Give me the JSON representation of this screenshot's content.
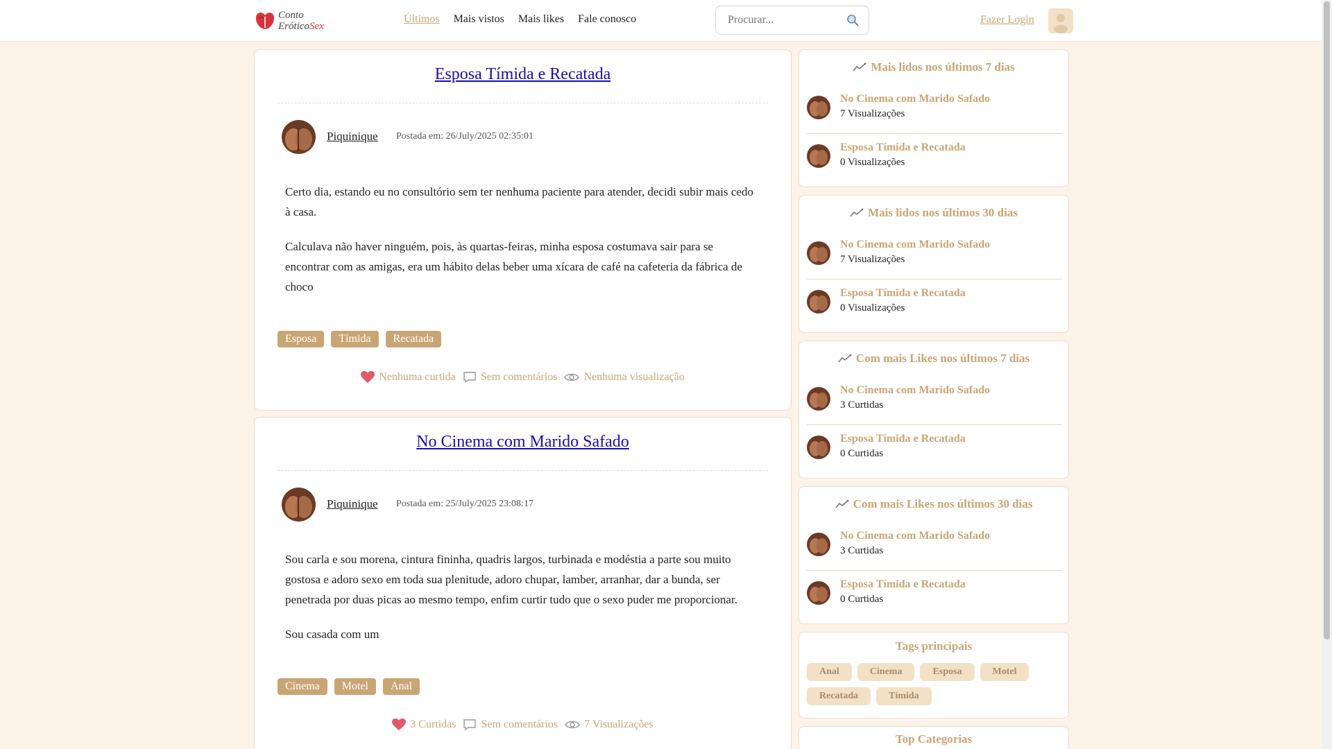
{
  "header": {
    "logo_line1": "Conto",
    "logo_line2": "Erótico",
    "logo_line3": "Sex",
    "nav": [
      "Últimos",
      "Mais vistos",
      "Mais likes",
      "Fale conosco"
    ],
    "search_placeholder": "Procurar...",
    "login": "Fazer Login"
  },
  "posts": [
    {
      "title": "Esposa Tímida e Recatada",
      "author": "Piquinique",
      "date": "Postada em: 26/July/2025 02:35:01",
      "paragraphs": [
        "Certo dia, estando eu no consultório sem ter nenhuma paciente para atender, decidi subir mais cedo à casa.",
        "Calculava não haver ninguém, pois, às quartas-feiras, minha esposa costumava sair para se encontrar com as amigas, era um hábito delas beber uma xícara de café na cafeteria da fábrica de choco"
      ],
      "tags": [
        "Esposa",
        "Tímida",
        "Recatada"
      ],
      "likes": "Nenhuma curtida",
      "comments": "Sem comentários",
      "views": "Nenhuma visualização"
    },
    {
      "title": "No Cinema com Marido Safado",
      "author": "Piquinique",
      "date": "Postada em: 25/July/2025 23:08:17",
      "paragraphs": [
        "Sou carla e sou morena, cintura fininha, quadris largos, turbinada e modéstia a parte sou muito gostosa e adoro sexo em toda sua plenitude, adoro chupar, lamber, arranhar, dar a bunda, ser penetrada por duas picas ao mesmo tempo, enfim curtir tudo que o sexo puder me proporcionar.",
        "Sou casada com um"
      ],
      "tags": [
        "Cinema",
        "Motel",
        "Anal"
      ],
      "likes": "3 Curtidas",
      "comments": "Sem comentários",
      "views": "7 Visualizações"
    }
  ],
  "sidebar": [
    {
      "title": "Mais lidos nos últimos 7 dias",
      "items": [
        {
          "name": "No Cinema com Marido Safado",
          "meta": "7 Visualizações"
        },
        {
          "name": "Esposa Tímida e Recatada",
          "meta": "0 Visualizações"
        }
      ]
    },
    {
      "title": "Mais lidos nos últimos 30 dias",
      "items": [
        {
          "name": "No Cinema com Marido Safado",
          "meta": "7 Visualizações"
        },
        {
          "name": "Esposa Tímida e Recatada",
          "meta": "0 Visualizações"
        }
      ]
    },
    {
      "title": "Com mais Likes nos últimos 7 dias",
      "items": [
        {
          "name": "No Cinema com Marido Safado",
          "meta": "3 Curtidas"
        },
        {
          "name": "Esposa Tímida e Recatada",
          "meta": "0 Curtidas"
        }
      ]
    },
    {
      "title": "Com mais Likes nos últimos 30 dias",
      "items": [
        {
          "name": "No Cinema com Marido Safado",
          "meta": "3 Curtidas"
        },
        {
          "name": "Esposa Tímida e Recatada",
          "meta": "0 Curtidas"
        }
      ]
    }
  ],
  "tags_box": {
    "title": "Tags principais",
    "tags": [
      "Anal",
      "Cinema",
      "Esposa",
      "Motel",
      "Recatada",
      "Tímida"
    ]
  },
  "categories_box": {
    "title": "Top Categorias"
  },
  "colors": {
    "accent": "#c9a574",
    "background": "#fdf3e8",
    "link": "#1a0dab",
    "heart": "#e05a6a"
  },
  "icons": [
    "search-icon",
    "heart-icon",
    "comment-icon",
    "eye-icon",
    "trend-icon",
    "user-icon"
  ]
}
